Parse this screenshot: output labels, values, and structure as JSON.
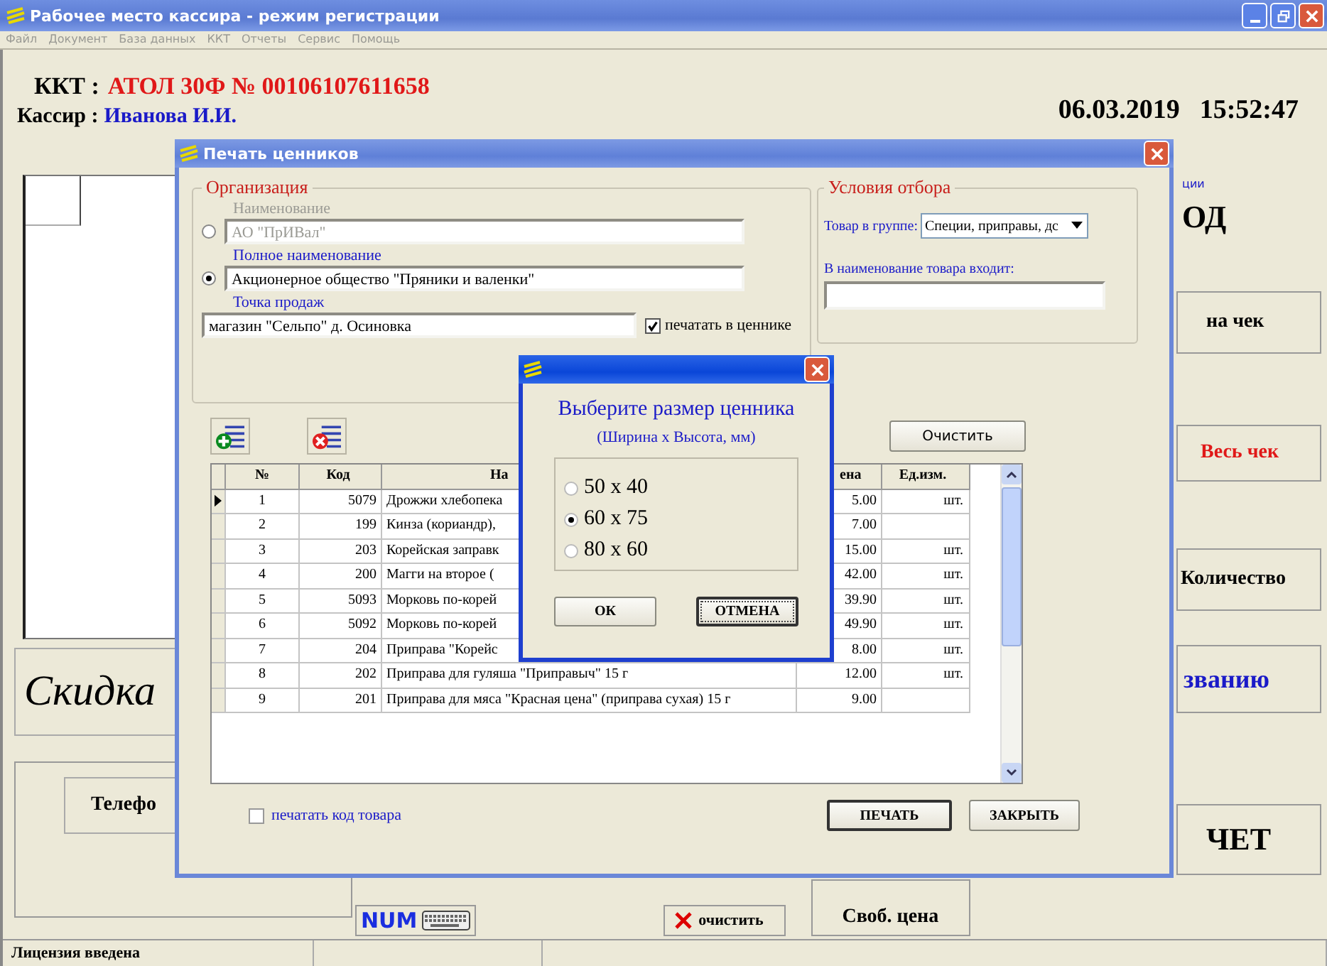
{
  "window": {
    "title": "Рабочее место кассира - режим регистрации"
  },
  "menu": [
    "Файл",
    "Документ",
    "База данных",
    "ККТ",
    "Отчеты",
    "Сервис",
    "Помощь"
  ],
  "header": {
    "kkt_label": "ККТ :",
    "kkt_value": "АТОЛ 30Ф  № 00106107611658",
    "cashier_label": "Кассир :",
    "cashier_value": "Иванова И.И.",
    "date": "06.03.2019",
    "time": "15:52:47"
  },
  "left_panel": {
    "discount_button": "Скидка",
    "phone_button": "Телефо"
  },
  "right_panel": {
    "caption": "ции",
    "code_text": "ОД",
    "buttons": [
      {
        "label": "на чек",
        "kind": "plain"
      },
      {
        "label": "Весь чек",
        "kind": "red"
      },
      {
        "label": "Количество",
        "kind": "plain"
      },
      {
        "label": "званию",
        "kind": "blue"
      },
      {
        "label": "ЧЕТ",
        "kind": "big"
      }
    ]
  },
  "bottom_bar": {
    "num_button": "NUM",
    "clear_button": "очистить",
    "free_price": "Своб. цена"
  },
  "status_bar": [
    "Лицензия введена"
  ],
  "print_dialog": {
    "title": "Печать ценников",
    "organization": {
      "legend": "Организация",
      "options": [
        {
          "label": "Наименование",
          "value": "АО \"ПрИВал\"",
          "selected": false,
          "disabled": true
        },
        {
          "label": "Полное наименование",
          "value": "Акционерное общество \"Пряники и валенки\"",
          "selected": true,
          "disabled": false
        }
      ],
      "sale_point_label": "Точка продаж",
      "sale_point": "магазин \"Сельпо\" д. Осиновка",
      "print_in_tag": {
        "label": "печатать в ценнике",
        "checked": true
      }
    },
    "filter": {
      "legend": "Условия отбора",
      "group_label": "Товар в группе:",
      "group_value": "Специи, приправы, дс",
      "name_label": "В наименование товара входит:"
    },
    "clear_button": "Очистить",
    "table": {
      "columns": [
        "№",
        "Код",
        "На",
        "ена",
        "Ед.изм."
      ],
      "rows": [
        {
          "no": "1",
          "code": "5079",
          "name": "Дрожжи хлебопека",
          "price": "5.00",
          "unit": "шт.",
          "selected": true
        },
        {
          "no": "2",
          "code": "199",
          "name": "Кинза (кориандр),",
          "price": "7.00",
          "selected": false
        },
        {
          "no": "3",
          "code": "203",
          "name": "Корейская заправк",
          "price": "15.00",
          "unit": "шт.",
          "selected": false
        },
        {
          "no": "4",
          "code": "200",
          "name": "Магги на второе (",
          "price": "42.00",
          "unit": "шт.",
          "selected": false
        },
        {
          "no": "5",
          "code": "5093",
          "name": "Морковь по-корей",
          "price": "39.90",
          "unit": "шт.",
          "selected": false
        },
        {
          "no": "6",
          "code": "5092",
          "name": "Морковь по-корей",
          "price": "49.90",
          "unit": "шт.",
          "selected": false
        },
        {
          "no": "7",
          "code": "204",
          "name": "Приправа \"Корейс",
          "price": "8.00",
          "unit": "шт.",
          "selected": false
        },
        {
          "no": "8",
          "code": "202",
          "name": "Приправа для гуляша \"Приправыч\" 15 г",
          "price": "12.00",
          "unit": "шт.",
          "selected": false
        },
        {
          "no": "9",
          "code": "201",
          "name": "Приправа для мяса \"Красная цена\" (приправа сухая) 15 г",
          "price": "9.00",
          "selected": false
        }
      ]
    },
    "print_code": {
      "label": "печатать код товара",
      "checked": false
    },
    "buttons": [
      "ПЕЧАТЬ",
      "ЗАКРЫТЬ"
    ]
  },
  "size_dialog": {
    "heading": "Выберите размер ценника",
    "subheading": "(Ширина х Высота, мм)",
    "options": [
      {
        "label": "50 х 40",
        "selected": false
      },
      {
        "label": "60 х 75",
        "selected": true
      },
      {
        "label": "80 х 60",
        "selected": false
      }
    ],
    "buttons": [
      {
        "label": "ОК",
        "focused": false
      },
      {
        "label": "ОТМЕНА",
        "focused": true
      }
    ]
  }
}
